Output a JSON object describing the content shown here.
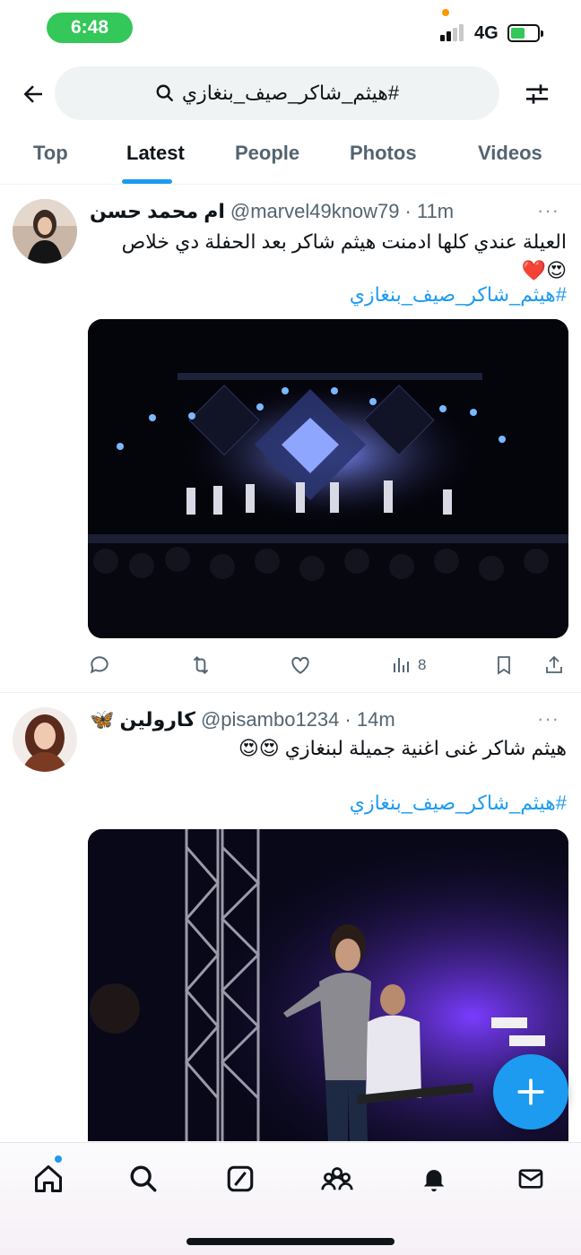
{
  "status_bar": {
    "time": "6:48",
    "network": "4G",
    "battery_fill": 0.55,
    "time_pill_color": "#34c759",
    "signal_bars_filled": 2,
    "signal_bars_total": 4
  },
  "search": {
    "query": "#هيثم_شاكر_صيف_بنغازي",
    "back_icon": "arrow-left-icon",
    "filter_icon": "sliders-icon"
  },
  "tabs": [
    {
      "label": "Top"
    },
    {
      "label": "Latest"
    },
    {
      "label": "People"
    },
    {
      "label": "Photos"
    },
    {
      "label": "Videos"
    }
  ],
  "active_tab": "Latest",
  "accent_color": "#1d9bf0",
  "tweets": [
    {
      "name": "ام محمد حسن",
      "handle": "@marvel49know79",
      "time": "· 11m",
      "more": "···",
      "text": "العيلة عندي كلها ادمنت هيثم شاكر بعد الحفلة دي خلاص",
      "emoji": "😍❤️",
      "hashtag": "#هيثم_شاكر_صيف_بنغازي",
      "views": "8",
      "media_description_icon": "concert-stage-photo"
    },
    {
      "name": "كارولين",
      "name_emoji": "🦋",
      "handle": "@pisambo1234",
      "time": "· 14m",
      "more": "···",
      "text": "هيثم شاكر غنى اغنية جميلة لبنغازي 😍😍",
      "hashtag": "#هيثم_شاكر_صيف_بنغازي",
      "media_description_icon": "singer-on-stage-photo"
    }
  ],
  "fab": {
    "icon": "plus-icon"
  },
  "bottom_nav": [
    "home-icon",
    "search-icon",
    "grok-icon",
    "communities-icon",
    "notifications-icon",
    "messages-icon"
  ]
}
